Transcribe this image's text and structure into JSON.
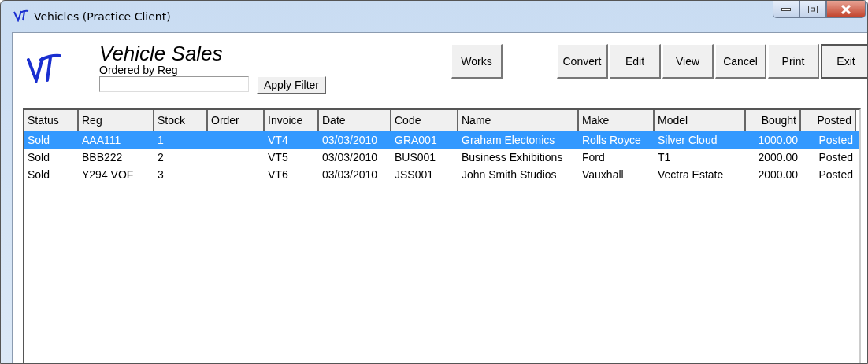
{
  "window": {
    "title": "Vehicles (Practice Client)"
  },
  "header": {
    "title": "Vehicle Sales",
    "subtitle": "Ordered by Reg",
    "filter_button": "Apply Filter"
  },
  "toolbar": [
    {
      "label": "Works",
      "kind": "solo"
    },
    {
      "label": "Convert",
      "kind": "group"
    },
    {
      "label": "Edit",
      "kind": "group"
    },
    {
      "label": "View",
      "kind": "group"
    },
    {
      "label": "Cancel",
      "kind": "group"
    },
    {
      "label": "Print",
      "kind": "group"
    },
    {
      "label": "Exit",
      "kind": "default"
    }
  ],
  "table": {
    "columns": [
      {
        "label": "Status",
        "kind": "text"
      },
      {
        "label": "Reg",
        "kind": "text"
      },
      {
        "label": "Stock",
        "kind": "text"
      },
      {
        "label": "Order",
        "kind": "text"
      },
      {
        "label": "Invoice",
        "kind": "text"
      },
      {
        "label": "Date",
        "kind": "text"
      },
      {
        "label": "Code",
        "kind": "text"
      },
      {
        "label": "Name",
        "kind": "text"
      },
      {
        "label": "Make",
        "kind": "text"
      },
      {
        "label": "Model",
        "kind": "text"
      },
      {
        "label": "Bought",
        "kind": "number"
      },
      {
        "label": "Posted",
        "kind": "number"
      }
    ],
    "rows": [
      {
        "selected": true,
        "cells": [
          "Sold",
          "AAA111",
          "1",
          "",
          "VT4",
          "03/03/2010",
          "GRA001",
          "Graham Electonics",
          "Rolls Royce",
          "Silver Cloud",
          "1000.00",
          "Posted"
        ]
      },
      {
        "selected": false,
        "cells": [
          "Sold",
          "BBB222",
          "2",
          "",
          "VT5",
          "03/03/2010",
          "BUS001",
          "Business Exhibitions",
          "Ford",
          "T1",
          "2000.00",
          "Posted"
        ]
      },
      {
        "selected": false,
        "cells": [
          "Sold",
          "Y294 VOF",
          "3",
          "",
          "VT6",
          "03/03/2010",
          "JSS001",
          "John Smith Studios",
          "Vauxhall",
          "Vectra Estate",
          "2000.00",
          "Posted"
        ]
      }
    ]
  }
}
